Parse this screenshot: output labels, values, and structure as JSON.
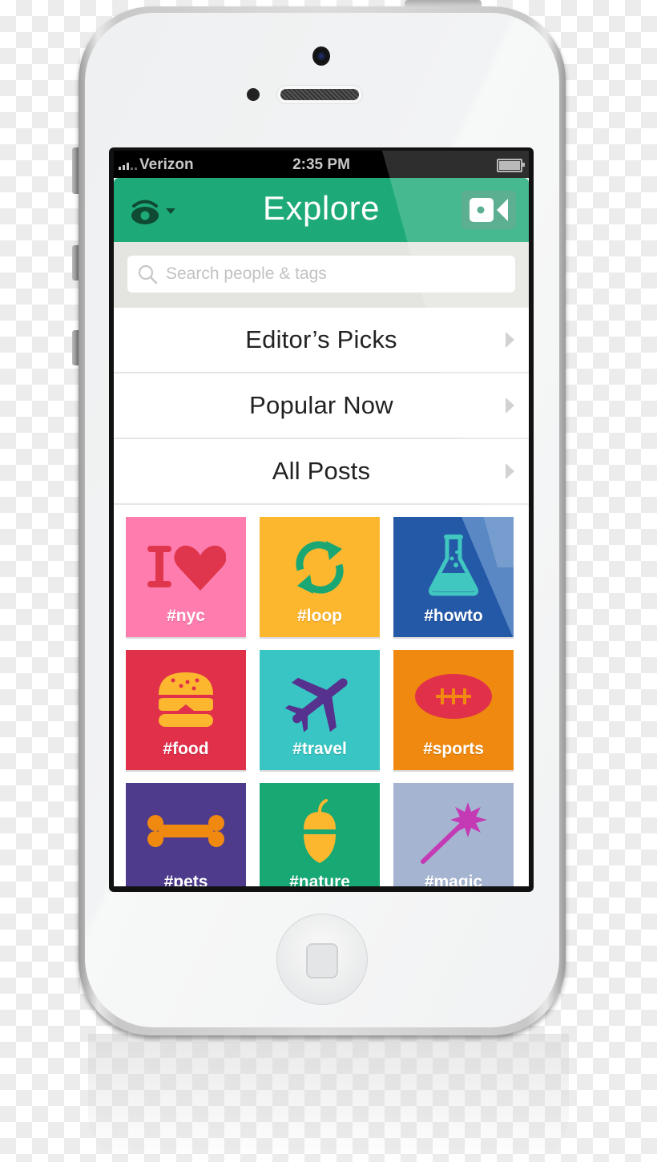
{
  "status_bar": {
    "carrier": "Verizon",
    "time": "2:35 PM",
    "battery_icon": "battery-full-icon",
    "signal_icon": "signal-bars-icon"
  },
  "nav": {
    "title": "Explore",
    "left_icon": "eye-icon",
    "left_dropdown_icon": "caret-down-icon",
    "right_icon": "video-camera-icon",
    "color": "#1eaa78"
  },
  "search": {
    "placeholder": "Search people & tags",
    "value": ""
  },
  "menu": [
    {
      "label": "Editor’s Picks"
    },
    {
      "label": "Popular Now"
    },
    {
      "label": "All Posts"
    }
  ],
  "tiles": [
    {
      "label": "#nyc",
      "icon": "i-heart-icon",
      "color": "#fe7dae"
    },
    {
      "label": "#loop",
      "icon": "loop-arrows-icon",
      "color": "#fdb72f"
    },
    {
      "label": "#howto",
      "icon": "flask-icon",
      "color": "#2459a8"
    },
    {
      "label": "#food",
      "icon": "burger-icon",
      "color": "#e1304a"
    },
    {
      "label": "#travel",
      "icon": "airplane-icon",
      "color": "#38c5c3"
    },
    {
      "label": "#sports",
      "icon": "football-icon",
      "color": "#f0890f"
    },
    {
      "label": "#pets",
      "icon": "bone-icon",
      "color": "#4f3b8c"
    },
    {
      "label": "#nature",
      "icon": "acorn-icon",
      "color": "#17a874"
    },
    {
      "label": "#magic",
      "icon": "magic-wand-icon",
      "color": "#a5b4d1"
    }
  ]
}
